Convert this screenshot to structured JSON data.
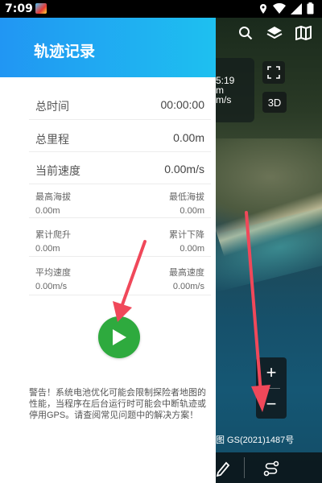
{
  "status_bar": {
    "time": "7:09"
  },
  "drawer": {
    "title": "轨迹记录",
    "rows": [
      {
        "label": "总时间",
        "value": "00:00:00"
      },
      {
        "label": "总里程",
        "value": "0.00m"
      },
      {
        "label": "当前速度",
        "value": "0.00m/s"
      }
    ],
    "pairs": [
      {
        "left_label": "最高海拔",
        "left_value": "0.00m",
        "right_label": "最低海拔",
        "right_value": "0.00m"
      },
      {
        "left_label": "累计爬升",
        "left_value": "0.00m",
        "right_label": "累计下降",
        "right_value": "0.00m"
      },
      {
        "left_label": "平均速度",
        "left_value": "0.00m/s",
        "right_label": "最高速度",
        "right_value": "0.00m/s"
      }
    ],
    "warning": "警告！系统电池优化可能会限制探险者地图的性能，当程序在后台运行时可能会中断轨迹或停用GPS。请查阅常见问题中的解决方案！"
  },
  "map": {
    "speed_card": {
      "line1": "5:19",
      "line2": "m",
      "line3": "m/s"
    },
    "btn_3d": "3D",
    "zoom_in": "+",
    "zoom_out": "−",
    "approval": "图 GS(2021)1487号"
  },
  "colors": {
    "header_start": "#2196f3",
    "header_end": "#1ec0f0",
    "play": "#2eaa3e",
    "arrow": "#f0485a"
  }
}
